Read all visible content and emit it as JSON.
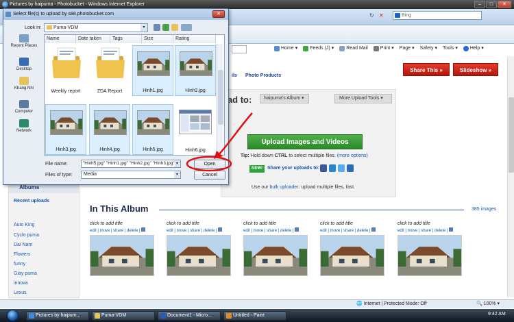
{
  "browser": {
    "title": "Pictures by haipuma - Photobucket - Windows Internet Explorer",
    "search_placeholder": "Bing",
    "toolbar": {
      "home": "Home",
      "feeds": "Feeds (J)",
      "read_mail": "Read Mail",
      "print": "Print",
      "page": "Page",
      "safety": "Safety",
      "tools": "Tools",
      "help": "Help"
    },
    "status_zone": "Internet | Protected Mode: Off",
    "zoom": "100%"
  },
  "dialog": {
    "title": "Select file(s) to upload by s88.photobucket.com",
    "look_in_label": "Look in:",
    "look_in_value": "Puma-VDM",
    "columns": [
      "Name",
      "Date taken",
      "Tags",
      "Size",
      "Rating"
    ],
    "places": [
      "Recent Places",
      "Desktop",
      "Khang Nhi",
      "Computer",
      "Network"
    ],
    "files": [
      {
        "name": "Weekly report",
        "kind": "folder",
        "selected": false
      },
      {
        "name": "ZDA Report",
        "kind": "folder",
        "selected": false
      },
      {
        "name": "Hinh1.jpg",
        "kind": "photo",
        "selected": true
      },
      {
        "name": "Hinh2.jpg",
        "kind": "photo",
        "selected": true
      },
      {
        "name": "Hinh3.jpg",
        "kind": "photo",
        "selected": true
      },
      {
        "name": "Hinh4.jpg",
        "kind": "photo",
        "selected": true
      },
      {
        "name": "Hinh5.jpg",
        "kind": "photo",
        "selected": true
      },
      {
        "name": "Hinh6.jpg",
        "kind": "screenshot",
        "selected": false
      }
    ],
    "file_name_label": "File name:",
    "file_name_value": "\"Hinh5.jpg\" \"Hinh1.jpg\" \"Hinh2.jpg\" \"Hinh3.jpg\"",
    "file_type_label": "Files of type:",
    "file_type_value": "Media",
    "open_label": "Open",
    "cancel_label": "Cancel"
  },
  "page": {
    "subnav": [
      "ils",
      "Photo Products"
    ],
    "share_this": "Share This »",
    "slideshow": "Slideshow »",
    "upload_to": "oad to:",
    "album_select": "haipuma's Album",
    "more_tools": "More Upload Tools",
    "upload_button": "Upload Images and Videos",
    "tip_prefix": "Tip:",
    "tip_body": "Hold down",
    "tip_key": "CTRL",
    "tip_rest": "to select multiple files.",
    "tip_link": "(more options)",
    "new_badge": "NEW!",
    "share_uploads": "Share your uploads to:",
    "bulk_prefix": "Use our",
    "bulk_link": "bulk uploader",
    "bulk_rest": ": upload multiple files, fast",
    "albums_header": "Albums",
    "recent_uploads": "Recent uploads",
    "album_links": [
      "Auto King",
      "Cyclo puma",
      "Dai Nam",
      "Flowers",
      "funny",
      "Giay puma",
      "innova",
      "Lexus"
    ],
    "in_album_title": "In This Album",
    "album_count": "385 images",
    "photo_caption": "click to add title",
    "photo_actions": "edit | move | share | delete |"
  },
  "taskbar": {
    "items": [
      "Pictures by haipum...",
      "Puma-VDM",
      "Document1 - Micro...",
      "Untitled - Paint"
    ],
    "clock": "9:42 AM"
  },
  "colors": {
    "accent_red": "#c21f12",
    "upload_green": "#3a9a36",
    "link_blue": "#1a55b4",
    "annotation": "#e01010"
  }
}
